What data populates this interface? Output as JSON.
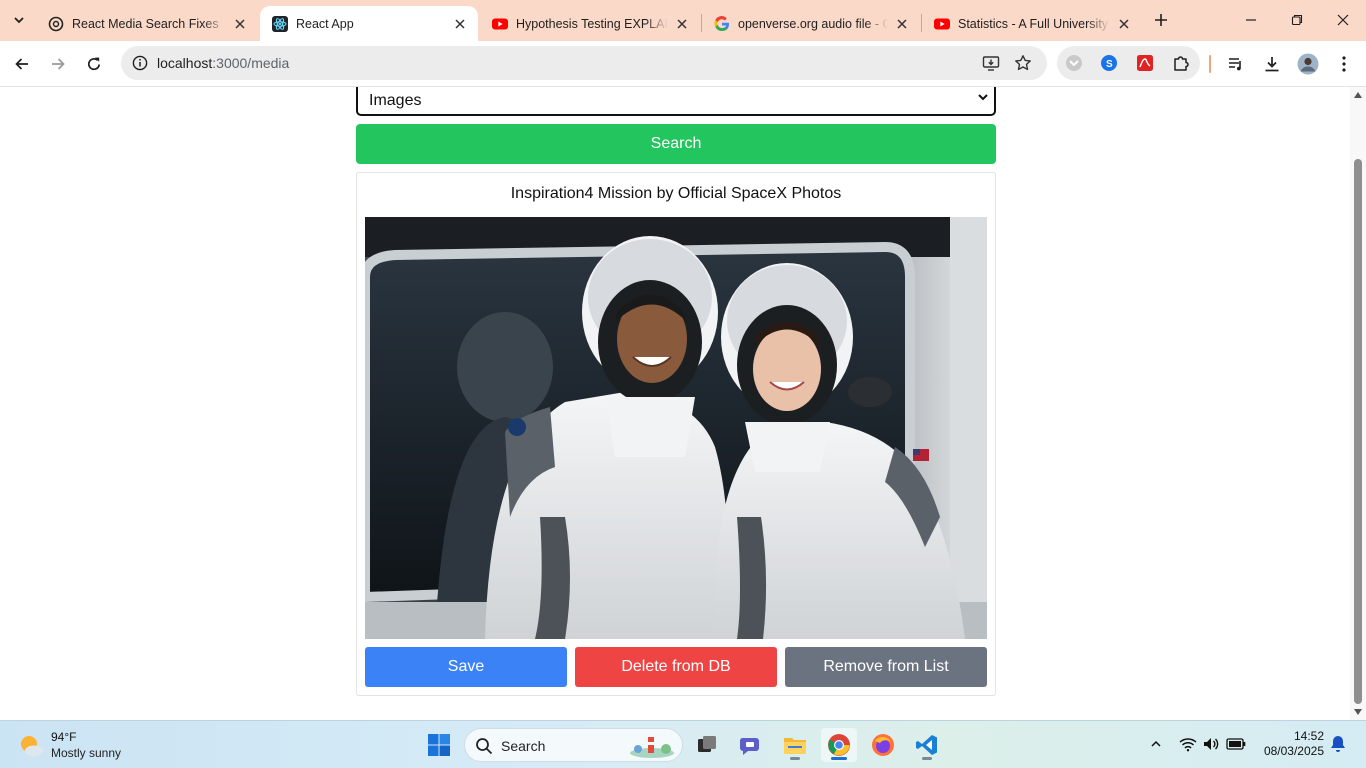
{
  "browser": {
    "tabs": [
      {
        "title": "React Media Search Fixes",
        "favicon": "openai-icon",
        "active": false
      },
      {
        "title": "React App",
        "favicon": "react-icon",
        "active": true
      },
      {
        "title": "Hypothesis Testing EXPLAINED",
        "favicon": "youtube-icon",
        "active": false
      },
      {
        "title": "openverse.org audio file - Google",
        "favicon": "google-icon",
        "active": false
      },
      {
        "title": "Statistics - A Full University Course",
        "favicon": "youtube-icon",
        "active": false
      }
    ],
    "url_host": "localhost",
    "url_path": ":3000/media"
  },
  "page": {
    "media_type": {
      "selected": "Images"
    },
    "search_button": "Search",
    "result": {
      "title": "Inspiration4 Mission by Official SpaceX Photos",
      "save_label": "Save",
      "delete_label": "Delete from DB",
      "remove_label": "Remove from List"
    },
    "colors": {
      "search": "#22c55e",
      "save": "#3b82f6",
      "delete": "#ef4444",
      "remove": "#6b7280"
    }
  },
  "taskbar": {
    "weather": {
      "temp": "94°F",
      "condition": "Mostly sunny"
    },
    "search_placeholder": "Search",
    "clock": {
      "time": "14:52",
      "date": "08/03/2025"
    }
  }
}
